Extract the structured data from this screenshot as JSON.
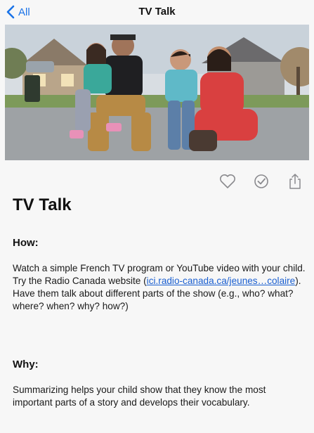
{
  "navbar": {
    "back_label": "All",
    "title": "TV Talk"
  },
  "actions": {
    "favorite_icon": "heart-icon",
    "done_icon": "check-circle-icon",
    "share_icon": "share-icon"
  },
  "article": {
    "title": "TV Talk",
    "how_heading": "How:",
    "how_text_1": "Watch a simple French TV program or YouTube video with your child. Try the Radio Canada website (",
    "how_link": "ici.radio-canada.ca/jeunes…colaire",
    "how_text_2": "). Have them talk about different parts of the show (e.g., who? what? where? when? why? how?)",
    "why_heading": "Why:",
    "why_text": "Summarizing helps your child show that they know the most important parts of a story and develops their vocabulary."
  },
  "colors": {
    "accent": "#1a73e8",
    "link": "#1a5fd0"
  }
}
